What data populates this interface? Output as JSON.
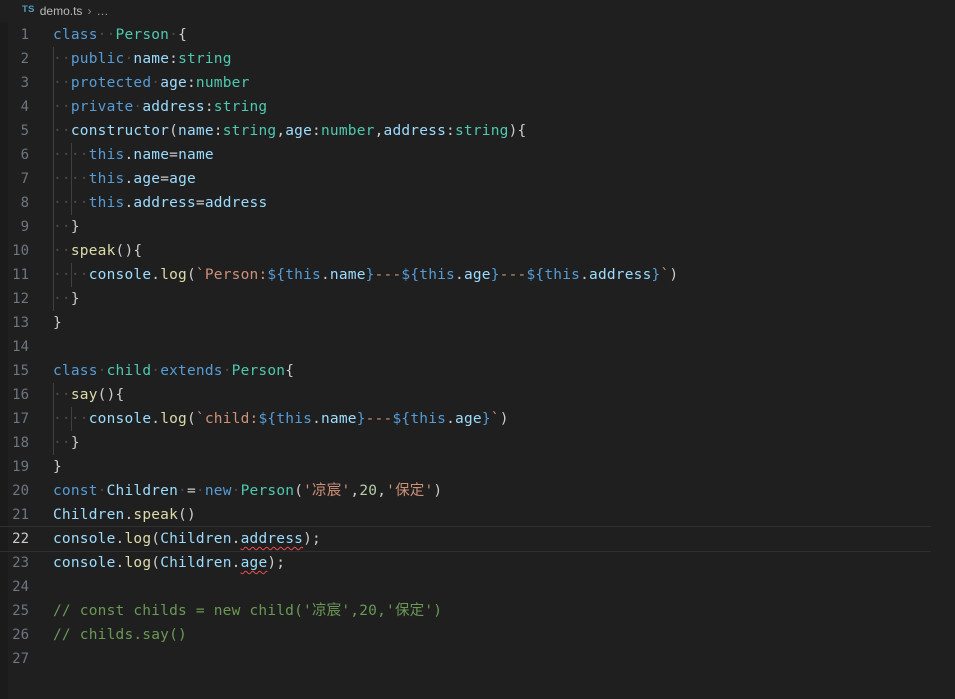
{
  "breadcrumb": {
    "badge": "TS",
    "file": "demo.ts",
    "separator": "›",
    "more": "…"
  },
  "editor": {
    "language": "typescript",
    "current_line": 22,
    "total_lines_shown": 27,
    "colors": {
      "background": "#1f1f1f",
      "line_number": "#6e7681",
      "line_number_active": "#cccccc",
      "keyword": "#569cd6",
      "type": "#4ec9b0",
      "variable": "#9cdcfe",
      "function": "#dcdcaa",
      "string": "#ce9178",
      "number": "#b5cea8",
      "comment": "#6a9955",
      "plain": "#cccccc",
      "error_squiggle": "#f14c4c",
      "indent_guide": "#404040",
      "whitespace_dot": "#4a4a4a"
    },
    "line_numbers": [
      1,
      2,
      3,
      4,
      5,
      6,
      7,
      8,
      9,
      10,
      11,
      12,
      13,
      14,
      15,
      16,
      17,
      18,
      19,
      20,
      21,
      22,
      23,
      24,
      25,
      26,
      27
    ],
    "lines": [
      "class  Person {",
      "  public name:string",
      "  protected age:number",
      "  private address:string",
      "  constructor(name:string,age:number,address:string){",
      "    this.name=name",
      "    this.age=age",
      "    this.address=address",
      "  }",
      "  speak(){",
      "    console.log(`Person:${this.name}---${this.age}---${this.address}`)",
      "  }",
      "}",
      "",
      "class child extends Person{",
      "  say(){",
      "    console.log(`child:${this.name}---${this.age}`)",
      "  }",
      "}",
      "const Children = new Person('凉宸',20,'保定')",
      "Children.speak()",
      "console.log(Children.address);",
      "console.log(Children.age);",
      "",
      "// const childs = new child('凉宸',20,'保定')",
      "// childs.say()",
      ""
    ],
    "errors": [
      {
        "line": 22,
        "token": "address"
      },
      {
        "line": 23,
        "token": "age"
      }
    ]
  }
}
